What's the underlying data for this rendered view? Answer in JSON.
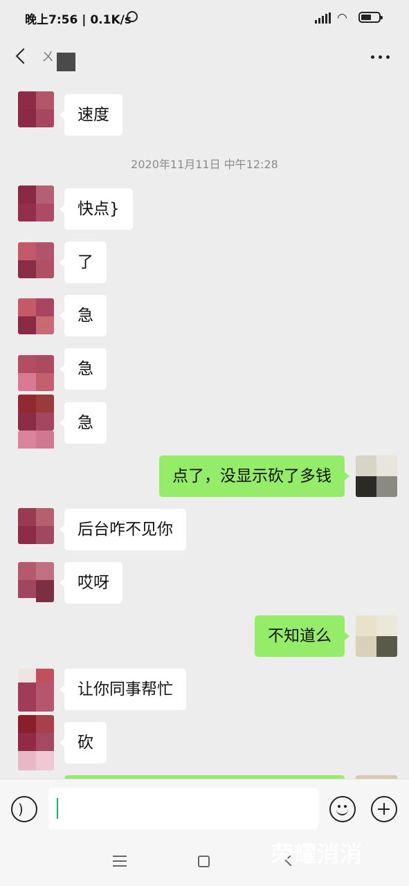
{
  "status_bar": {
    "time_and_speed": "晚上7:56 | 0.1K/s",
    "icons": [
      "alarm-icon",
      "signal-icon",
      "wifi-icon",
      "battery-icon"
    ]
  },
  "header": {
    "contact_name": "ㄨ",
    "icons": [
      "back-arrow-icon",
      "more-icon"
    ]
  },
  "messages": [
    {
      "side": "in",
      "text": "速度"
    },
    {
      "type": "time",
      "text": "2020年11月11日 中午12:28"
    },
    {
      "side": "in",
      "text": "快点}"
    },
    {
      "side": "in",
      "text": "了"
    },
    {
      "side": "in",
      "text": "急"
    },
    {
      "side": "in",
      "text": "急"
    },
    {
      "side": "in",
      "text": "急"
    },
    {
      "side": "out",
      "text": "点了，没显示砍了多钱"
    },
    {
      "side": "in",
      "text": "后台咋不见你"
    },
    {
      "side": "in",
      "text": "哎呀"
    },
    {
      "side": "out",
      "text": "不知道么"
    },
    {
      "side": "in",
      "text": "让你同事帮忙"
    },
    {
      "side": "in",
      "text": "砍"
    }
  ],
  "input_bar": {
    "value": "",
    "icons": [
      "voice-icon",
      "emoji-icon",
      "plus-icon"
    ]
  },
  "nav_bar": {
    "icons": [
      "menu-icon",
      "home-icon",
      "back-icon"
    ]
  },
  "watermark": "荣耀消消"
}
